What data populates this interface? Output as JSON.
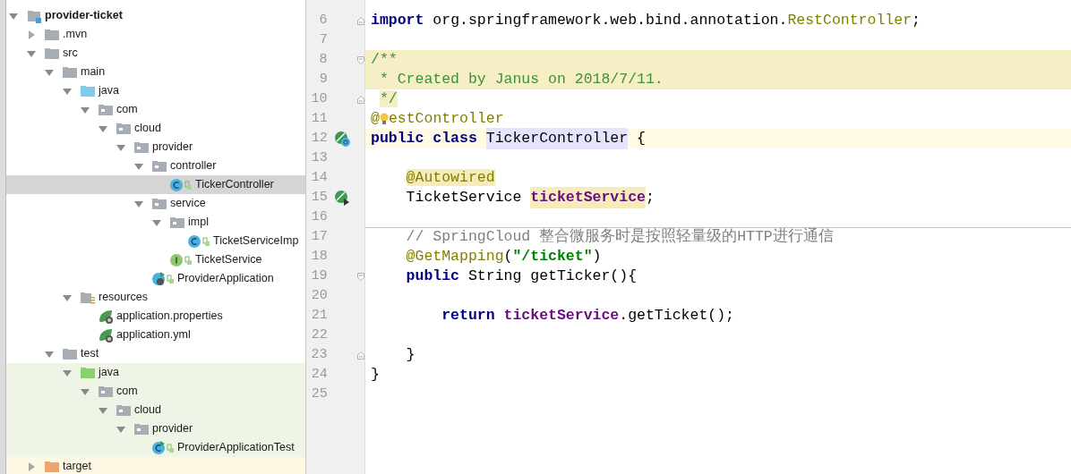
{
  "project_tree": [
    {
      "name": "provider-ticket",
      "kind": "module",
      "expanded": true,
      "selected": false,
      "children": [
        {
          "name": ".mvn",
          "kind": "folder",
          "expanded": false,
          "selected": false
        },
        {
          "name": "src",
          "kind": "folder",
          "expanded": true,
          "selected": false,
          "children": [
            {
              "name": "main",
              "kind": "folder",
              "expanded": true,
              "selected": false,
              "children": [
                {
                  "name": "java",
                  "kind": "source-folder",
                  "expanded": true,
                  "selected": false,
                  "children": [
                    {
                      "name": "com",
                      "kind": "package",
                      "expanded": true,
                      "selected": false,
                      "children": [
                        {
                          "name": "cloud",
                          "kind": "package",
                          "expanded": true,
                          "selected": false,
                          "children": [
                            {
                              "name": "provider",
                              "kind": "package",
                              "expanded": true,
                              "selected": false,
                              "children": [
                                {
                                  "name": "controller",
                                  "kind": "package",
                                  "expanded": true,
                                  "selected": false,
                                  "children": [
                                    {
                                      "name": "TickerController",
                                      "kind": "class",
                                      "selected": true
                                    }
                                  ]
                                },
                                {
                                  "name": "service",
                                  "kind": "package",
                                  "expanded": true,
                                  "selected": false,
                                  "children": [
                                    {
                                      "name": "impl",
                                      "kind": "package",
                                      "expanded": true,
                                      "selected": false,
                                      "children": [
                                        {
                                          "name": "TicketServiceImp",
                                          "kind": "class",
                                          "selected": false
                                        }
                                      ]
                                    },
                                    {
                                      "name": "TicketService",
                                      "kind": "interface",
                                      "selected": false
                                    }
                                  ]
                                },
                                {
                                  "name": "ProviderApplication",
                                  "kind": "spring-app",
                                  "selected": false
                                }
                              ]
                            }
                          ]
                        }
                      ]
                    }
                  ]
                },
                {
                  "name": "resources",
                  "kind": "resources-folder",
                  "expanded": true,
                  "selected": false,
                  "children": [
                    {
                      "name": "application.properties",
                      "kind": "spring-config",
                      "selected": false
                    },
                    {
                      "name": "application.yml",
                      "kind": "spring-config",
                      "selected": false
                    }
                  ]
                }
              ]
            },
            {
              "name": "test",
              "kind": "folder",
              "expanded": true,
              "selected": false,
              "children": [
                {
                  "name": "java",
                  "kind": "test-folder",
                  "expanded": true,
                  "selected": false,
                  "color": "#eef5e6",
                  "children": [
                    {
                      "name": "com",
                      "kind": "package",
                      "expanded": true,
                      "selected": false,
                      "color": "#eef5e6",
                      "children": [
                        {
                          "name": "cloud",
                          "kind": "package",
                          "expanded": true,
                          "selected": false,
                          "color": "#eef5e6",
                          "children": [
                            {
                              "name": "provider",
                              "kind": "package",
                              "expanded": true,
                              "selected": false,
                              "color": "#eef5e6",
                              "children": [
                                {
                                  "name": "ProviderApplicationTest",
                                  "kind": "test-class",
                                  "selected": false,
                                  "color": "#eef5e6"
                                }
                              ]
                            }
                          ]
                        }
                      ]
                    }
                  ]
                }
              ]
            }
          ]
        },
        {
          "name": "target",
          "kind": "excluded-folder",
          "expanded": false,
          "selected": false,
          "color": "#fdf8e4"
        }
      ]
    }
  ],
  "editor": {
    "lines": [
      {
        "number": "6",
        "fold_end": true,
        "tokens": [
          {
            "text": "import",
            "kind": "keyword"
          },
          {
            "text": " org.springframework.web.bind.annotation.",
            "kind": "plain"
          },
          {
            "text": "RestController",
            "kind": "annotation"
          },
          {
            "text": ";",
            "kind": "plain"
          }
        ]
      },
      {
        "number": "7"
      },
      {
        "number": "8",
        "fold_start": true,
        "in_doc_block": true,
        "tokens": [
          {
            "text": "/**",
            "kind": "doc-comment"
          }
        ]
      },
      {
        "number": "9",
        "in_doc_block": true,
        "tokens": [
          {
            "text": " * Created by Janus on 2018/7/11.",
            "kind": "doc-comment"
          }
        ]
      },
      {
        "number": "10",
        "fold_end": true,
        "tokens": [
          {
            "text": " */",
            "kind": "doc-comment-marked"
          }
        ]
      },
      {
        "number": "11",
        "tokens": [
          {
            "text": "@",
            "kind": "annotation"
          },
          {
            "kind": "bulb"
          },
          {
            "text": "estController",
            "kind": "annotation"
          }
        ]
      },
      {
        "number": "12",
        "gutter_icons": [
          {
            "kind": "bean-class"
          }
        ],
        "current": true,
        "tokens": [
          {
            "text": "public class ",
            "kind": "keyword"
          },
          {
            "text": "TickerController",
            "kind": "declaration"
          },
          {
            "text": " {",
            "kind": "plain"
          }
        ]
      },
      {
        "number": "13"
      },
      {
        "number": "14",
        "tokens": [
          {
            "text": "    @Autowired",
            "kind": "annotation-marked"
          }
        ]
      },
      {
        "number": "15",
        "gutter_icons": [
          {
            "kind": "bean-inject"
          }
        ],
        "tokens": [
          {
            "text": "    TicketService ",
            "kind": "plain"
          },
          {
            "text": "ticketService",
            "kind": "field-marked"
          },
          {
            "text": ";",
            "kind": "plain"
          }
        ]
      },
      {
        "number": "16"
      },
      {
        "number": "17",
        "separator": true,
        "tokens": [
          {
            "text": "    // SpringCloud 整合微服务时是按照轻量级的HTTP进行通信",
            "kind": "comment"
          }
        ]
      },
      {
        "number": "18",
        "tokens": [
          {
            "text": "    @GetMapping",
            "kind": "annotation"
          },
          {
            "text": "(",
            "kind": "plain"
          },
          {
            "text": "\"/ticket\"",
            "kind": "string"
          },
          {
            "text": ")",
            "kind": "plain"
          }
        ]
      },
      {
        "number": "19",
        "fold_start": true,
        "tokens": [
          {
            "text": "    public",
            "kind": "keyword"
          },
          {
            "text": " String getTicker(){",
            "kind": "plain"
          }
        ]
      },
      {
        "number": "20"
      },
      {
        "number": "21",
        "tokens": [
          {
            "text": "        return ",
            "kind": "keyword"
          },
          {
            "text": "ticketService",
            "kind": "field"
          },
          {
            "text": ".getTicket();",
            "kind": "plain"
          }
        ]
      },
      {
        "number": "22"
      },
      {
        "number": "23",
        "fold_end": true,
        "tokens": [
          {
            "text": "    }",
            "kind": "plain"
          }
        ]
      },
      {
        "number": "24",
        "tokens": [
          {
            "text": "}",
            "kind": "plain"
          }
        ]
      },
      {
        "number": "25"
      }
    ]
  }
}
